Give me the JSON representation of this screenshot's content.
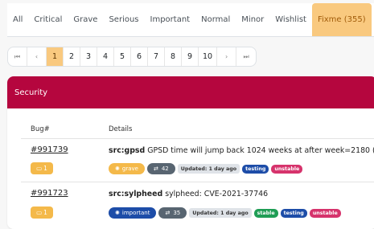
{
  "tabs": [
    {
      "label": "All"
    },
    {
      "label": "Critical"
    },
    {
      "label": "Grave"
    },
    {
      "label": "Serious"
    },
    {
      "label": "Important"
    },
    {
      "label": "Normal"
    },
    {
      "label": "Minor"
    },
    {
      "label": "Wishlist"
    },
    {
      "label": "Fixme (355)",
      "active": true
    }
  ],
  "pager": {
    "first": "⏮",
    "prev": "‹",
    "pages": [
      "1",
      "2",
      "3",
      "4",
      "5",
      "6",
      "7",
      "8",
      "9",
      "10"
    ],
    "active_page": "1",
    "next": "›",
    "last": "⏭"
  },
  "card": {
    "title": "Security",
    "header_color": "#b5063e",
    "columns": {
      "bug": "Bug#",
      "details": "Details"
    },
    "rows": [
      {
        "bug": "#991739",
        "package": "src:gpsd",
        "description": "GPSD time will jump back 1024 weeks at after week=2180 (23-Oct",
        "comments": "1",
        "severity": "grave",
        "duplicates": "42",
        "updated": "Updated: 1 day ago",
        "tags": [
          "testing",
          "unstable"
        ]
      },
      {
        "bug": "#991723",
        "package": "src:sylpheed",
        "description": "sylpheed: CVE-2021-37746",
        "comments": "1",
        "severity": "important",
        "duplicates": "35",
        "updated": "Updated: 1 day ago",
        "tags": [
          "stable",
          "testing",
          "unstable"
        ]
      }
    ]
  },
  "colors": {
    "accent": "#f9c97f",
    "security": "#b5063e",
    "grave": "#f4b94a",
    "important": "#1d4da8"
  }
}
